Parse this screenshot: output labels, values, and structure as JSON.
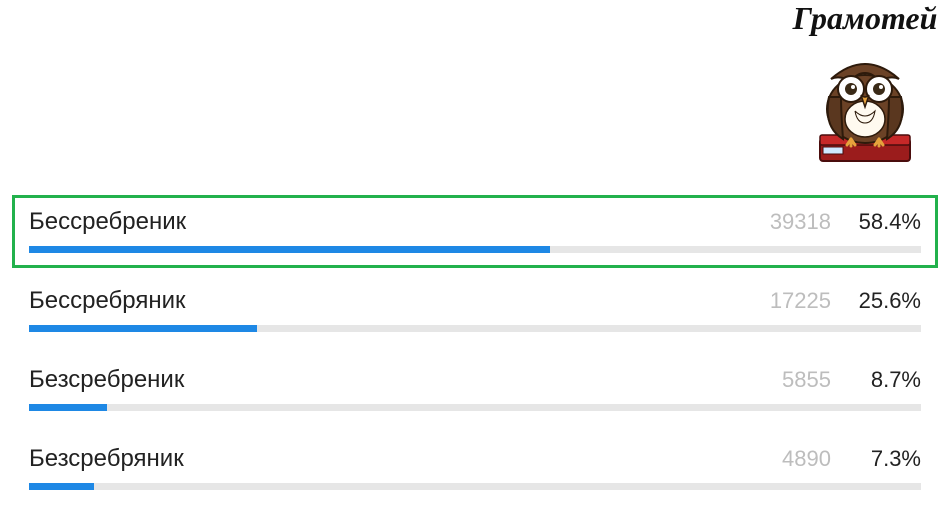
{
  "brand": "Грамотей",
  "chart_data": {
    "type": "bar",
    "title": "",
    "xlabel": "",
    "ylabel": "",
    "categories": [
      "Бессребреник",
      "Бессребряник",
      "Безсребреник",
      "Безсребряник"
    ],
    "series": [
      {
        "name": "votes",
        "values": [
          39318,
          17225,
          5855,
          4890
        ]
      },
      {
        "name": "percent",
        "values": [
          58.4,
          25.6,
          8.7,
          7.3
        ]
      }
    ],
    "highlight_index": 0,
    "ylim": [
      0,
      100
    ]
  },
  "options": [
    {
      "label": "Бессребреник",
      "count": "39318",
      "percent": "58.4%",
      "fill": 58.4,
      "correct": true
    },
    {
      "label": "Бессребряник",
      "count": "17225",
      "percent": "25.6%",
      "fill": 25.6,
      "correct": false
    },
    {
      "label": "Безсребреник",
      "count": "5855",
      "percent": "8.7%",
      "fill": 8.7,
      "correct": false
    },
    {
      "label": "Безсребряник",
      "count": "4890",
      "percent": "7.3%",
      "fill": 7.3,
      "correct": false
    }
  ]
}
